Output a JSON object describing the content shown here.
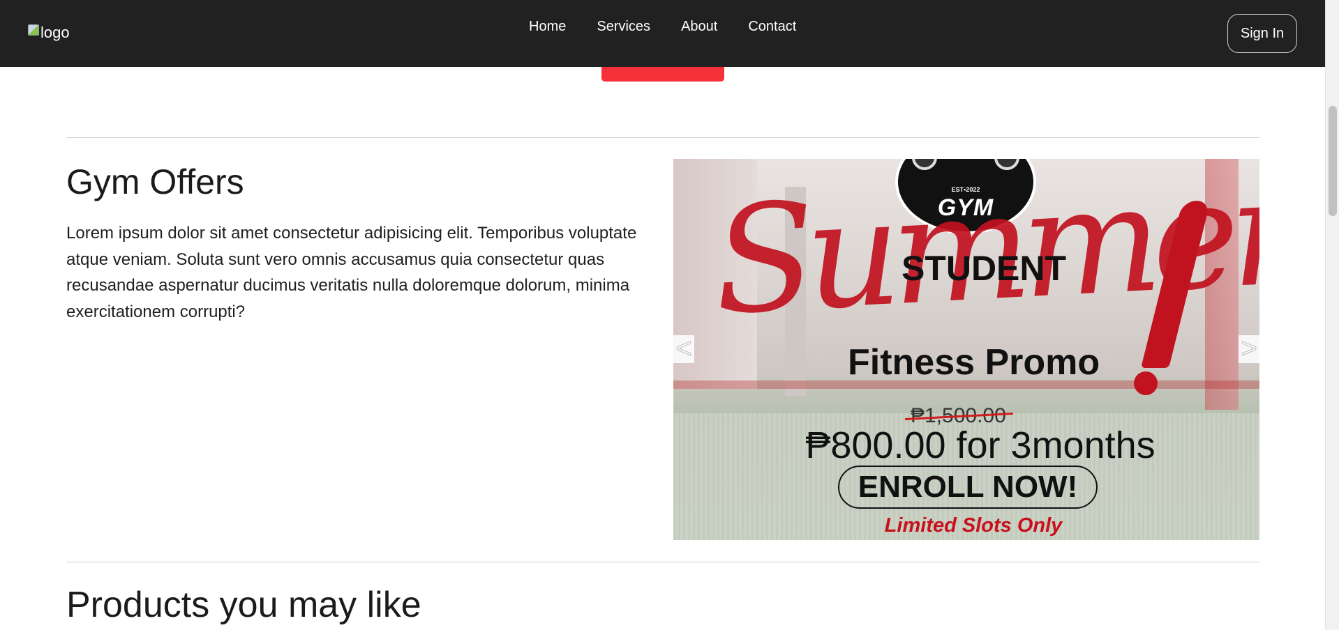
{
  "nav": {
    "logo_alt": "logo",
    "links": [
      "Home",
      "Services",
      "About",
      "Contact"
    ],
    "signin": "Sign In"
  },
  "offers": {
    "title": "Gym Offers",
    "text": "Lorem ipsum dolor sit amet consectetur adipisicing elit. Temporibus voluptate atque veniam. Soluta sunt vero omnis accusamus quia consectetur quas recusandae aspernatur ducimus veritatis nulla doloremque dolorum, minima exercitationem corrupti?"
  },
  "promo": {
    "badge_est": "EST•2022",
    "badge_name": "GYM",
    "student": "STUDENT",
    "script": "Summer",
    "fitness": "Fitness Promo",
    "old_price": "₱1,500.00",
    "new_price": "₱800.00 for 3months",
    "enroll": "ENROLL NOW!",
    "limited": "Limited Slots Only",
    "prev": "<",
    "next": ">"
  },
  "products": {
    "title": "Products you may like"
  },
  "colors": {
    "nav_bg": "#212121",
    "accent_red": "#f7313a",
    "promo_red": "#c1121f"
  }
}
